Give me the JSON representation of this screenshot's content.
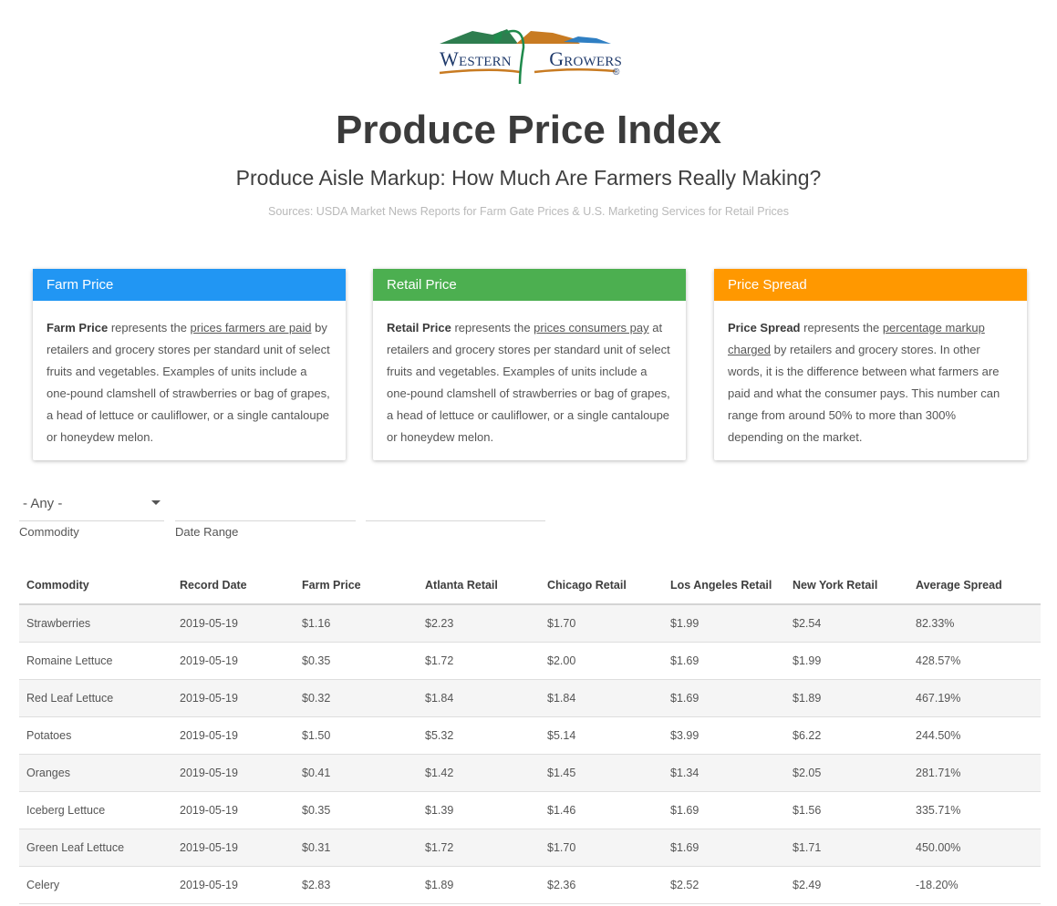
{
  "logo": {
    "word1": "Western",
    "word2": "Growers",
    "reg": "®"
  },
  "header": {
    "title": "Produce Price Index",
    "subtitle": "Produce Aisle Markup: How Much Are Farmers Really Making?",
    "sources": "Sources: USDA Market News Reports for Farm Gate Prices & U.S. Marketing Services for Retail Prices"
  },
  "cards": [
    {
      "title": "Farm Price",
      "color": "#2196f3",
      "term": "Farm Price",
      "pre": " represents the ",
      "link": "prices farmers are paid",
      "post": " by retailers and grocery stores per standard unit of select fruits and vegetables. Examples of units include a one-pound clamshell of strawberries or bag of grapes, a head of lettuce or cauliflower, or a single cantaloupe or honeydew melon."
    },
    {
      "title": "Retail Price",
      "color": "#4caf50",
      "term": "Retail Price",
      "pre": " represents the ",
      "link": "prices consumers pay",
      "post": " at retailers and grocery stores per standard unit of select fruits and vegetables. Examples of units include a one-pound clamshell of strawberries or bag of grapes, a head of lettuce or cauliflower, or a single cantaloupe or honeydew melon."
    },
    {
      "title": "Price Spread",
      "color": "#ff9800",
      "term": "Price Spread",
      "pre": " represents the ",
      "link": "percentage markup charged",
      "post": " by retailers and grocery stores. In other words, it is the difference between what farmers are paid and what the consumer pays. This number can range from around 50% to more than 300% depending on the market."
    }
  ],
  "filters": {
    "commodity_value": "- Any -",
    "commodity_label": "Commodity",
    "date_label": "Date Range",
    "date_from": "",
    "date_to": ""
  },
  "table": {
    "columns": [
      "Commodity",
      "Record Date",
      "Farm Price",
      "Atlanta Retail",
      "Chicago Retail",
      "Los Angeles Retail",
      "New York Retail",
      "Average Spread"
    ],
    "rows": [
      [
        "Strawberries",
        "2019-05-19",
        "$1.16",
        "$2.23",
        "$1.70",
        "$1.99",
        "$2.54",
        "82.33%"
      ],
      [
        "Romaine Lettuce",
        "2019-05-19",
        "$0.35",
        "$1.72",
        "$2.00",
        "$1.69",
        "$1.99",
        "428.57%"
      ],
      [
        "Red Leaf Lettuce",
        "2019-05-19",
        "$0.32",
        "$1.84",
        "$1.84",
        "$1.69",
        "$1.89",
        "467.19%"
      ],
      [
        "Potatoes",
        "2019-05-19",
        "$1.50",
        "$5.32",
        "$5.14",
        "$3.99",
        "$6.22",
        "244.50%"
      ],
      [
        "Oranges",
        "2019-05-19",
        "$0.41",
        "$1.42",
        "$1.45",
        "$1.34",
        "$2.05",
        "281.71%"
      ],
      [
        "Iceberg Lettuce",
        "2019-05-19",
        "$0.35",
        "$1.39",
        "$1.46",
        "$1.69",
        "$1.56",
        "335.71%"
      ],
      [
        "Green Leaf Lettuce",
        "2019-05-19",
        "$0.31",
        "$1.72",
        "$1.70",
        "$1.69",
        "$1.71",
        "450.00%"
      ],
      [
        "Celery",
        "2019-05-19",
        "$2.83",
        "$1.89",
        "$2.36",
        "$2.52",
        "$2.49",
        "-18.20%"
      ]
    ]
  }
}
